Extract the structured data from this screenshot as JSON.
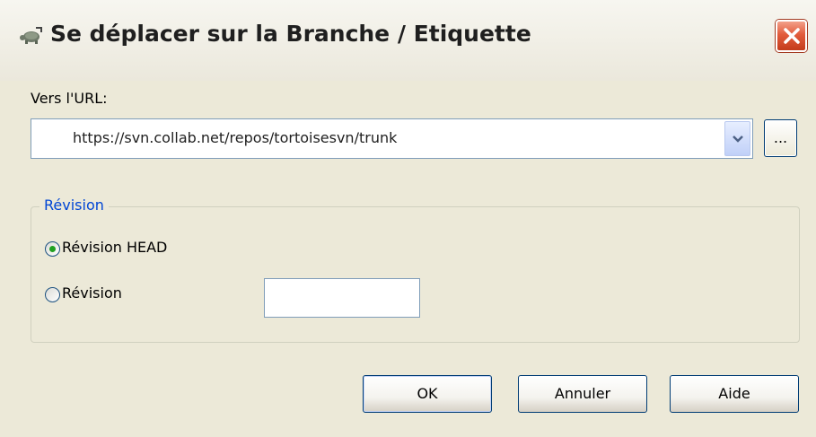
{
  "window": {
    "title": "Se déplacer sur la Branche / Etiquette",
    "title_icon": "tortoisesvn-switch-icon",
    "close_icon": "close-icon"
  },
  "url": {
    "label": "Vers l'URL:",
    "value": "https://svn.collab.net/repos/tortoisesvn/trunk",
    "dropdown_icon": "chevron-down-icon",
    "browse_label": "..."
  },
  "revision_group": {
    "title": "Révision",
    "head_label": "Révision HEAD",
    "head_selected": true,
    "specific_label": "Révision",
    "specific_selected": false,
    "specific_value": ""
  },
  "buttons": {
    "ok": "OK",
    "cancel": "Annuler",
    "help": "Aide"
  },
  "colors": {
    "dialog_bg": "#ece9d8",
    "group_title": "#0046d5",
    "close_button": "#e25c3c",
    "radio_selected": "#21a121"
  }
}
